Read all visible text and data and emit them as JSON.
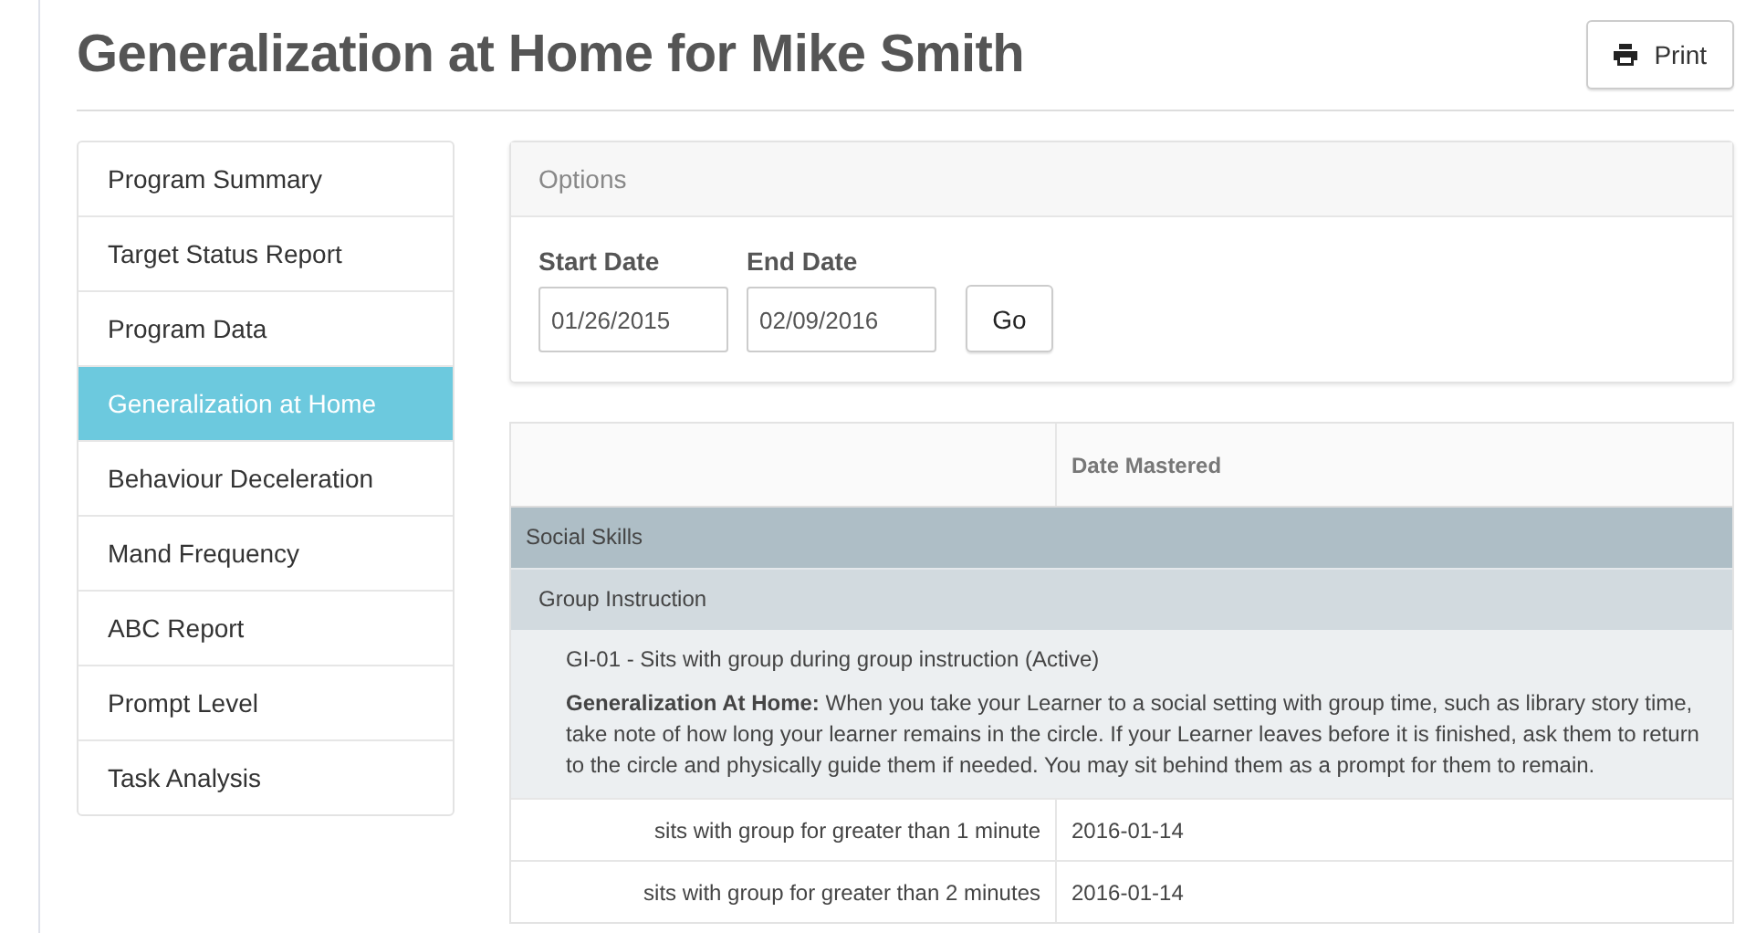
{
  "title": "Generalization at Home for Mike Smith",
  "print_button": {
    "label": "Print"
  },
  "sidebar": {
    "items": [
      {
        "label": "Program Summary",
        "selected": false
      },
      {
        "label": "Target Status Report",
        "selected": false
      },
      {
        "label": "Program Data",
        "selected": false
      },
      {
        "label": "Generalization at Home",
        "selected": true
      },
      {
        "label": "Behaviour Deceleration",
        "selected": false
      },
      {
        "label": "Mand Frequency",
        "selected": false
      },
      {
        "label": "ABC Report",
        "selected": false
      },
      {
        "label": "Prompt Level",
        "selected": false
      },
      {
        "label": "Task Analysis",
        "selected": false
      }
    ]
  },
  "options": {
    "heading": "Options",
    "start_date": {
      "label": "Start Date",
      "value": "01/26/2015"
    },
    "end_date": {
      "label": "End Date",
      "value": "02/09/2016"
    },
    "go_button": "Go"
  },
  "table": {
    "columns": [
      "Date Mastered"
    ],
    "rows": [
      {
        "kind": "domain",
        "text": "Social Skills"
      },
      {
        "kind": "program",
        "text": "Group Instruction"
      },
      {
        "kind": "target",
        "text": "GI-01 - Sits with group during group instruction (Active)",
        "note": "**Generalization At Home:**  When you take your Learner to a social setting with group time, such as library story time, take note of how long your learner remains in the circle. If your Learner leaves before it is finished, ask them to return to the circle and physically guide them if needed. You may sit behind them as a prompt for them to remain."
      },
      {
        "kind": "step",
        "text": "sits with group for greater than 1 minute",
        "date": "2016-01-14"
      },
      {
        "kind": "step",
        "text": "sits with group for greater than 2 minutes",
        "date": "2016-01-14"
      }
    ]
  }
}
